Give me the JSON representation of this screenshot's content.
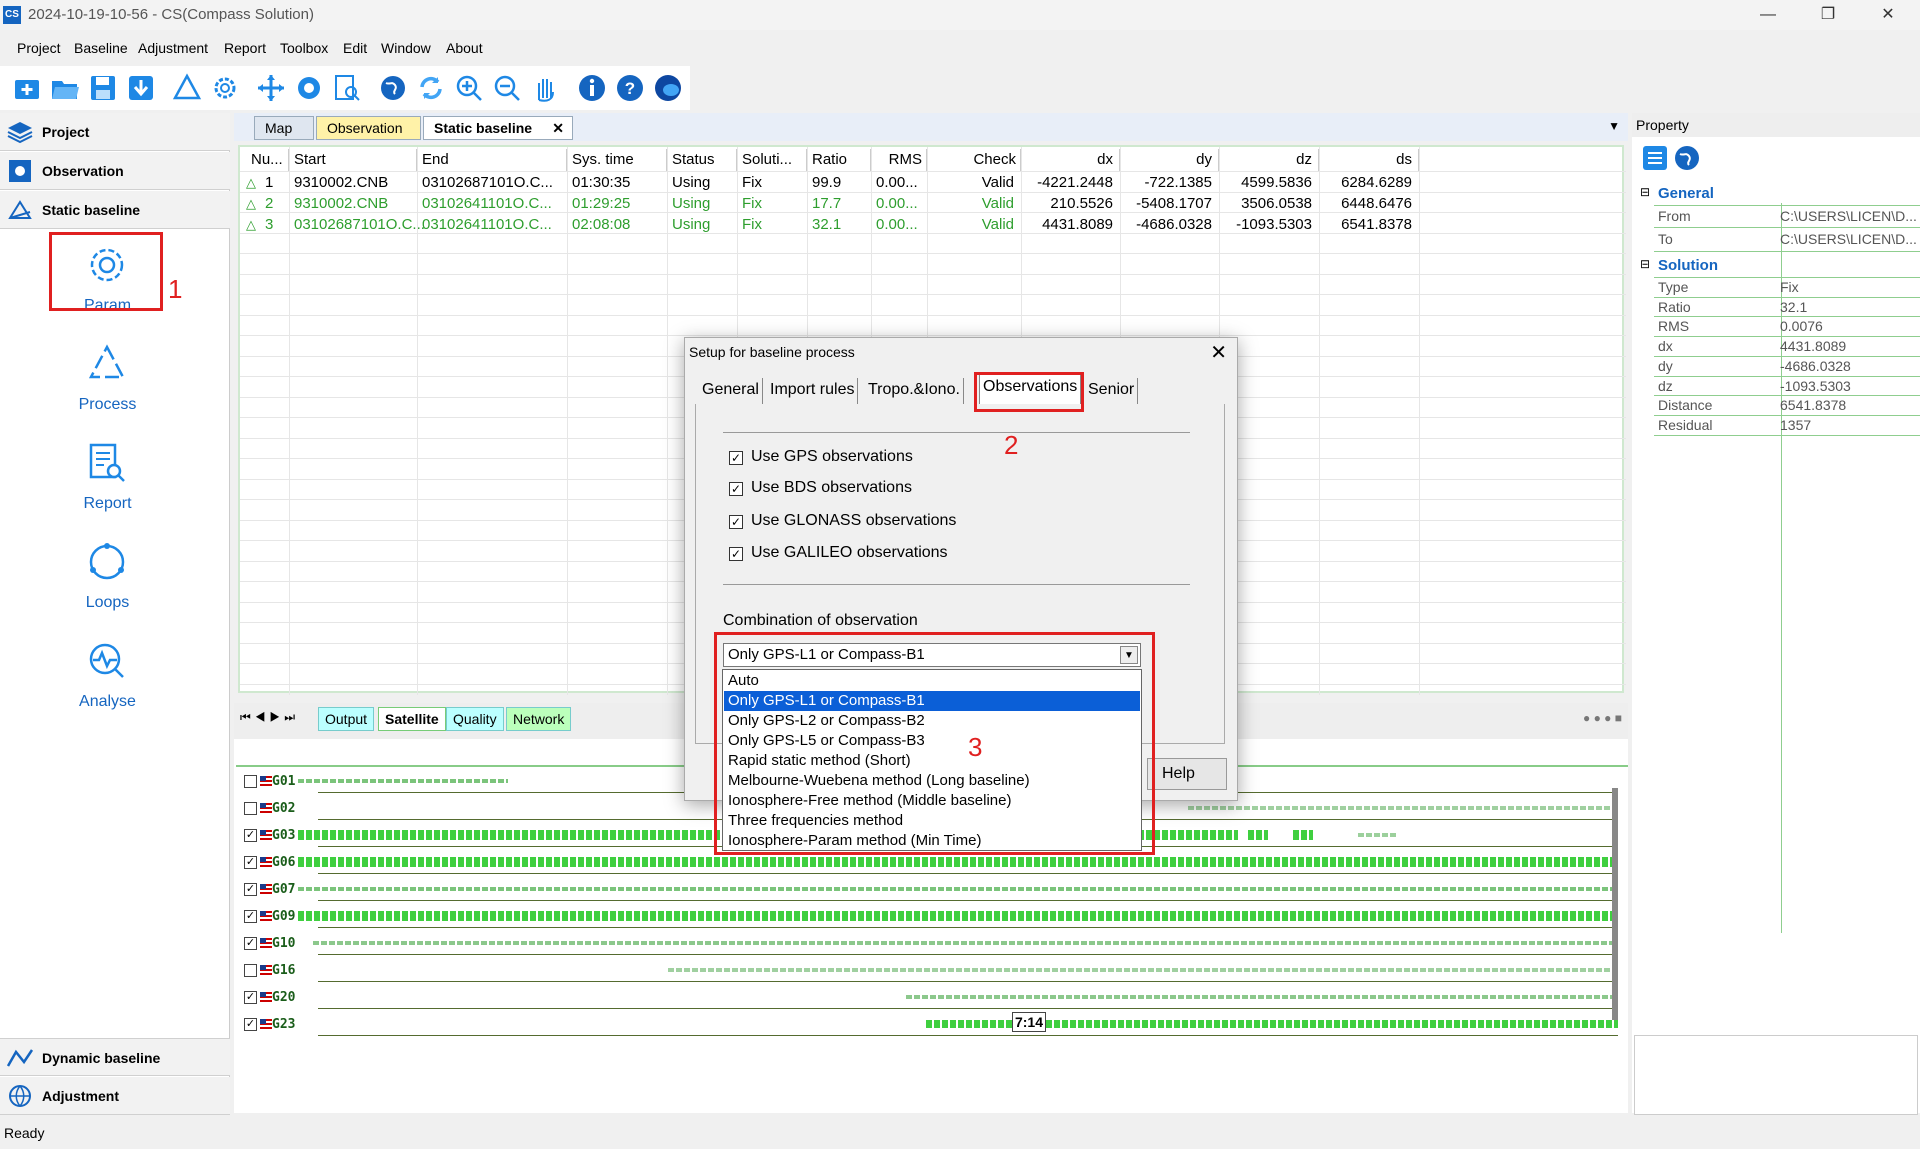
{
  "window": {
    "title": "2024-10-19-10-56 - CS(Compass Solution)"
  },
  "menu": [
    "Project",
    "Baseline",
    "Adjustment",
    "Report",
    "Toolbox",
    "Edit",
    "Window",
    "About"
  ],
  "nav": {
    "project": "Project",
    "observation": "Observation",
    "static_baseline": "Static baseline",
    "buttons": [
      "Param",
      "Process",
      "Report",
      "Loops",
      "Analyse"
    ],
    "dynamic_baseline": "Dynamic baseline",
    "adjustment": "Adjustment"
  },
  "annotations": {
    "n1": "1",
    "n2": "2",
    "n3": "3"
  },
  "doc_tabs": [
    "Map",
    "Observation",
    "Static baseline"
  ],
  "grid": {
    "headers": [
      "Nu...",
      "Start",
      "End",
      "Sys. time",
      "Status",
      "Soluti...",
      "Ratio",
      "RMS",
      "Check",
      "dx",
      "dy",
      "dz",
      "ds"
    ],
    "rows": [
      [
        "1",
        "9310002.CNB",
        "03102687101O.C...",
        "01:30:35",
        "Using",
        "Fix",
        "99.9",
        "0.00...",
        "Valid",
        "-4221.2448",
        "-722.1385",
        "4599.5836",
        "6284.6289"
      ],
      [
        "2",
        "9310002.CNB",
        "03102641101O.C...",
        "01:29:25",
        "Using",
        "Fix",
        "17.7",
        "0.00...",
        "Valid",
        "210.5526",
        "-5408.1707",
        "3506.0538",
        "6448.6476"
      ],
      [
        "3",
        "03102687101O.C...",
        "03102641101O.C...",
        "02:08:08",
        "Using",
        "Fix",
        "32.1",
        "0.00...",
        "Valid",
        "4431.8089",
        "-4686.0328",
        "-1093.5303",
        "6541.8378"
      ]
    ]
  },
  "property": {
    "title": "Property",
    "general": "General",
    "from_k": "From",
    "from_v": "C:\\USERS\\LICEN\\D...",
    "to_k": "To",
    "to_v": "C:\\USERS\\LICEN\\D...",
    "solution": "Solution",
    "items": [
      [
        "Type",
        "Fix"
      ],
      [
        "Ratio",
        "32.1"
      ],
      [
        "RMS",
        "0.0076"
      ],
      [
        "dx",
        "4431.8089"
      ],
      [
        "dy",
        "-4686.0328"
      ],
      [
        "dz",
        "-1093.5303"
      ],
      [
        "Distance",
        "6541.8378"
      ],
      [
        "Residual",
        "1357"
      ]
    ]
  },
  "bottom_tabs": [
    "Output",
    "Satellite",
    "Quality",
    "Network"
  ],
  "satellites": [
    "G01",
    "G02",
    "G03",
    "G06",
    "G07",
    "G09",
    "G10",
    "G16",
    "G20",
    "G23"
  ],
  "sat_checked": [
    false,
    false,
    true,
    true,
    true,
    true,
    true,
    false,
    true,
    true
  ],
  "time_label": "7:14",
  "status": "Ready",
  "dialog": {
    "title": "Setup for baseline process",
    "tabs": [
      "General",
      "Import rules",
      "Tropo.&Iono.",
      "Observations",
      "Senior"
    ],
    "checks": [
      "Use GPS observations",
      "Use BDS observations",
      "Use GLONASS observations",
      "Use GALILEO observations"
    ],
    "combo_label": "Combination of observation",
    "combo_value": "Only GPS-L1 or Compass-B1",
    "help": "Help",
    "options": [
      "Auto",
      "Only GPS-L1 or Compass-B1",
      "Only GPS-L2 or Compass-B2",
      "Only GPS-L5 or Compass-B3",
      "Rapid static method (Short)",
      "Melbourne-Wuebena method (Long baseline)",
      "Ionosphere-Free method (Middle baseline)",
      "Three frequencies method",
      "Ionosphere-Param method (Min Time)"
    ],
    "selected_option": "Only GPS-L1 or Compass-B1"
  }
}
